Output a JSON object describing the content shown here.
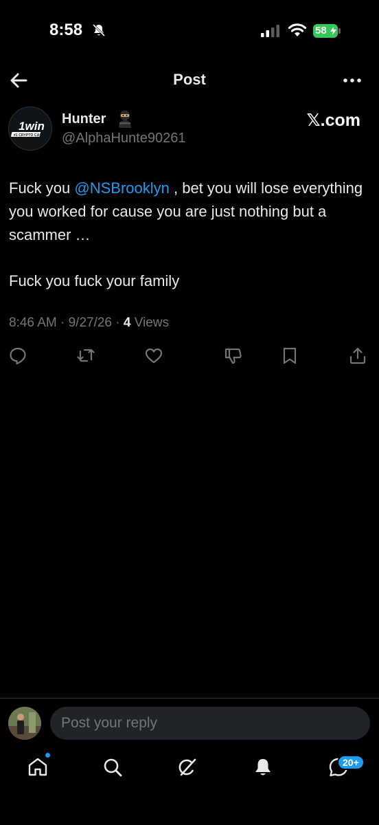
{
  "status_bar": {
    "time": "8:58",
    "battery": "58",
    "icons": [
      "bell-off-icon",
      "signal-icon",
      "wifi-icon",
      "battery-icon"
    ]
  },
  "header": {
    "title": "Post",
    "back_icon": "back-arrow-icon",
    "more_icon": "more-icon"
  },
  "post": {
    "display_name": "Hunter",
    "name_emoji": "ninja-emoji",
    "handle": "@AlphaHunte90261",
    "source_label": "𝕏.com",
    "avatar_logo": "1win #1 CRYPTO CASINO",
    "body": {
      "line1_pre": "Fuck you ",
      "mention": "@NSBrooklyn",
      "line1_post": " , bet you will lose everything you worked for cause you are just nothing but a scammer …",
      "line2": "Fuck you fuck your family"
    },
    "timestamp": "8:46 AM · 9/27/26 · ",
    "views_count": "4",
    "views_label": " Views"
  },
  "actions": [
    "reply-icon",
    "repost-icon",
    "like-icon",
    "dislike-icon",
    "bookmark-icon",
    "share-icon"
  ],
  "reply": {
    "placeholder": "Post your reply"
  },
  "bottom_nav": {
    "items": [
      "home-icon",
      "search-icon",
      "grok-icon",
      "notifications-icon",
      "messages-icon"
    ],
    "messages_badge": "20+"
  },
  "colors": {
    "background": "#000000",
    "accent": "#1d9bf0",
    "text": "#e7e9ea",
    "muted": "#71767b",
    "battery": "#34c759"
  }
}
